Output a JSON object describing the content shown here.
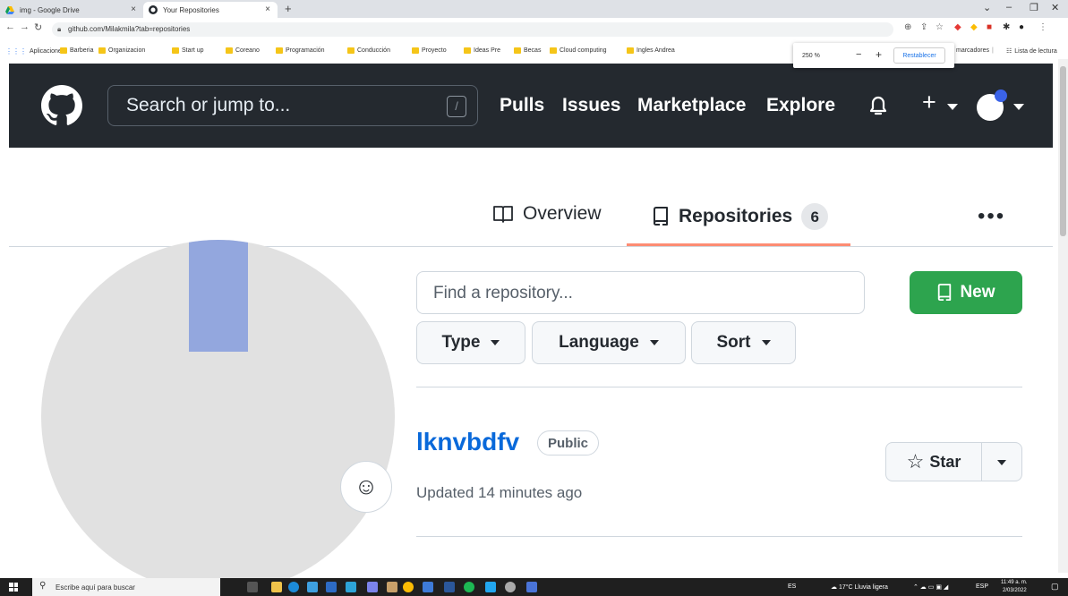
{
  "browser": {
    "tabs": [
      {
        "title": "img - Google Drive",
        "icon": "google-drive-icon"
      },
      {
        "title": "Your Repositories",
        "icon": "github-icon"
      }
    ],
    "url": "github.com/Milakmila?tab=repositories",
    "bookmarks": [
      "Aplicaciones",
      "Barberia",
      "Organizacion",
      "Start up",
      "Coreano",
      "Programación",
      "Conducción",
      "Proyecto",
      "Ideas Pre",
      "Becas",
      "Cloud computing",
      "Ingles Andrea"
    ],
    "bookmarks_right": "marcadores",
    "reading_list": "Lista de lectura",
    "zoom": {
      "value": "250 %",
      "minus": "−",
      "plus": "+",
      "reset": "Restablecer"
    }
  },
  "header": {
    "search_placeholder": "Search or jump to...",
    "slash": "/",
    "nav": [
      "Pulls",
      "Issues",
      "Marketplace",
      "Explore"
    ],
    "plus": "+"
  },
  "profile": {
    "tabs": {
      "overview": "Overview",
      "repositories": "Repositories",
      "repositories_count": "6"
    },
    "more": "•••",
    "emoji": "☺"
  },
  "repos": {
    "find_placeholder": "Find a repository...",
    "new_label": "New",
    "filters": [
      "Type",
      "Language",
      "Sort"
    ],
    "items": [
      {
        "name": "lknvbdfv",
        "visibility": "Public",
        "updated": "Updated 14 minutes ago",
        "star_label": "Star"
      }
    ]
  },
  "taskbar": {
    "search_placeholder": "Escribe aquí para buscar",
    "lang": "ES",
    "weather": "17°C  Lluvia ligera",
    "kbd": "ESP",
    "time": "11:49 a. m.",
    "date": "2/03/2022"
  },
  "colors": {
    "header_bg": "#24292f",
    "accent_green": "#2da44e",
    "link_blue": "#0969da",
    "tab_underline": "#fd8c73"
  }
}
